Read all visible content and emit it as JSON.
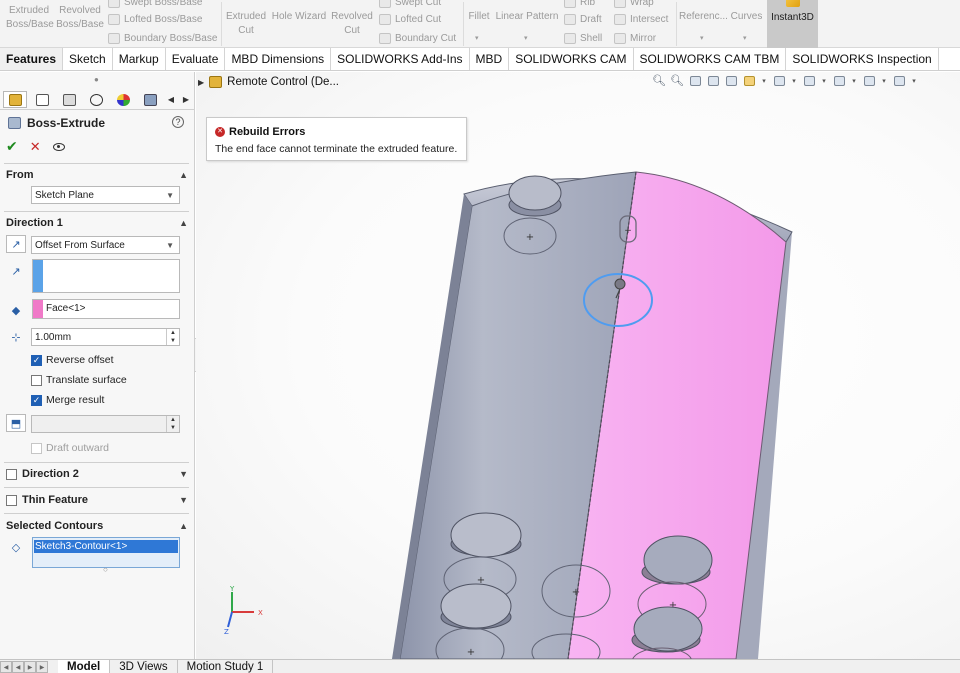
{
  "ribbon": {
    "buttons": [
      {
        "l1": "Extruded",
        "l2": "Boss/Base"
      },
      {
        "l1": "Revolved",
        "l2": "Boss/Base"
      },
      {
        "l1": "Extruded",
        "l2": "Cut"
      },
      {
        "l1": "Hole Wizard",
        "l2": ""
      },
      {
        "l1": "Revolved",
        "l2": "Cut"
      },
      {
        "l1": "Fillet",
        "l2": ""
      },
      {
        "l1": "Linear Pattern",
        "l2": ""
      },
      {
        "l1": "Referenc...",
        "l2": ""
      },
      {
        "l1": "Curves",
        "l2": ""
      }
    ],
    "small": {
      "swept_boss": "Swept Boss/Base",
      "lofted_boss": "Lofted Boss/Base",
      "boundary_boss": "Boundary Boss/Base",
      "swept_cut": "Swept Cut",
      "lofted_cut": "Lofted Cut",
      "boundary_cut": "Boundary Cut",
      "rib": "Rib",
      "draft": "Draft",
      "shell": "Shell",
      "wrap": "Wrap",
      "intersect": "Intersect",
      "mirror": "Mirror"
    },
    "instant3d": "Instant3D"
  },
  "tabs": [
    "Features",
    "Sketch",
    "Markup",
    "Evaluate",
    "MBD Dimensions",
    "SOLIDWORKS Add-Ins",
    "MBD",
    "SOLIDWORKS CAM",
    "SOLIDWORKS CAM TBM",
    "SOLIDWORKS Inspection"
  ],
  "property_manager": {
    "title": "Boss-Extrude",
    "help": "?",
    "from": {
      "heading": "From",
      "value": "Sketch Plane"
    },
    "direction1": {
      "heading": "Direction 1",
      "end_condition": "Offset From Surface",
      "face": "Face<1>",
      "offset": "1.00mm",
      "reverse_offset": "Reverse offset",
      "translate_surface": "Translate surface",
      "merge_result": "Merge result",
      "draft_outward": "Draft outward"
    },
    "direction2": {
      "heading": "Direction 2"
    },
    "thin_feature": {
      "heading": "Thin Feature"
    },
    "selected_contours": {
      "heading": "Selected Contours",
      "item": "Sketch3-Contour<1>"
    }
  },
  "graphics": {
    "tree_item": "Remote Control  (De...",
    "rebuild_title": "Rebuild Errors",
    "rebuild_message": "The end face cannot terminate the extruded feature.",
    "triad": {
      "y": "Y",
      "x": "X",
      "z": "Z"
    }
  },
  "bottom_tabs": [
    "Model",
    "3D Views",
    "Motion Study 1"
  ],
  "colors": {
    "accent": "#2f78d6",
    "highlight_face": "#f4a8f0",
    "body_face": "#a6acc0",
    "error": "#c62828"
  }
}
